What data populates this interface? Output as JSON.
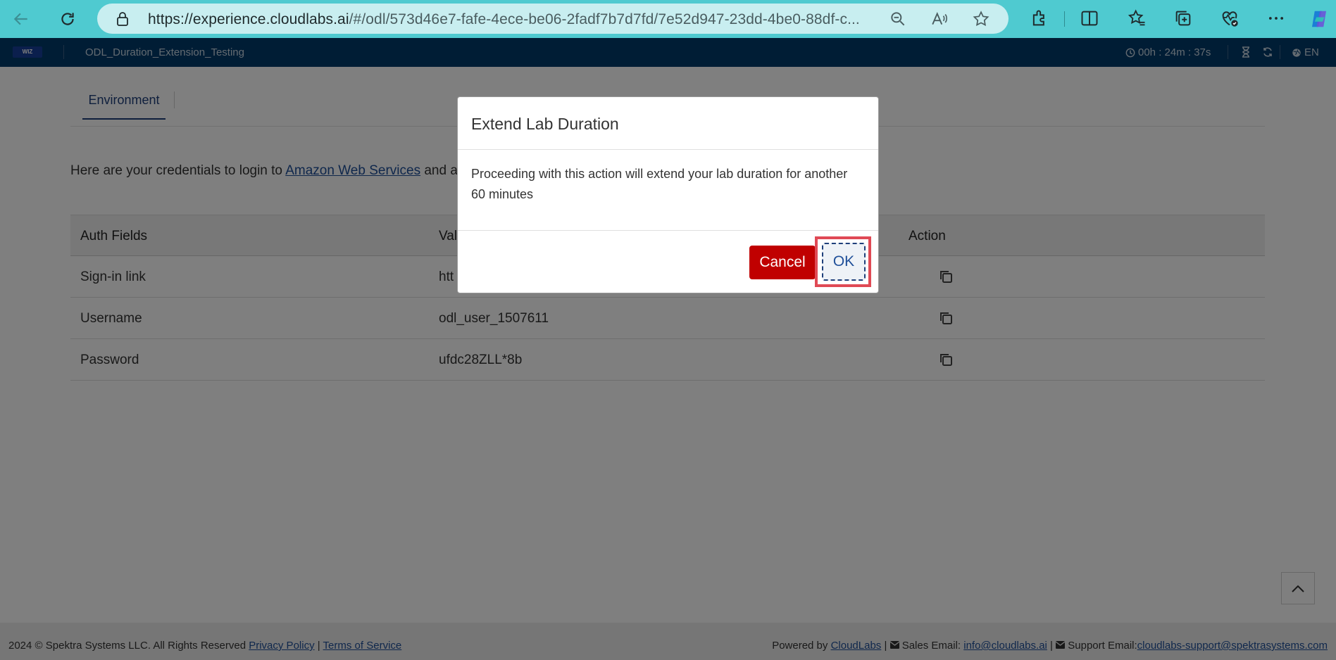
{
  "browser": {
    "url_main": "https://experience.cloudlabs.ai",
    "url_rest": "/#/odl/573d46e7-fafe-4ece-be06-2fadf7b7d7fd/7e52d947-23dd-4be0-88df-c..."
  },
  "header": {
    "logo_text": "WIZ",
    "lab_title": "ODL_Duration_Extension_Testing",
    "timer": "00h : 24m : 37s",
    "language": "EN"
  },
  "tabs": [
    {
      "label": "Environment"
    }
  ],
  "intro": {
    "prefix": "Here are your credentials to login to ",
    "link": "Amazon Web Services",
    "suffix": " and a"
  },
  "table": {
    "headers": [
      "Auth Fields",
      "Val",
      "Action"
    ],
    "rows": [
      {
        "field": "Sign-in link",
        "value": "htt"
      },
      {
        "field": "Username",
        "value": "odl_user_1507611"
      },
      {
        "field": "Password",
        "value": "ufdc28ZLL*8b"
      }
    ]
  },
  "modal": {
    "title": "Extend Lab Duration",
    "body": "Proceeding with this action will extend your lab duration for another 60 minutes",
    "cancel_label": "Cancel",
    "ok_label": "OK"
  },
  "footer": {
    "copyright": "2024 © Spektra Systems LLC. All Rights Reserved ",
    "privacy": "Privacy Policy",
    "sep": " | ",
    "terms": "Terms of Service",
    "powered_by": "Powered by ",
    "cloudlabs": "CloudLabs",
    "sales_label": " Sales Email: ",
    "sales_email": "info@cloudlabs.ai",
    "support_label": " Support Email:",
    "support_email": "cloudlabs-support@spektrasystems.com"
  },
  "colors": {
    "browser_bar": "#4fcad0",
    "app_header": "#003a6b",
    "cancel": "#c00000",
    "highlight": "#e04a55"
  }
}
